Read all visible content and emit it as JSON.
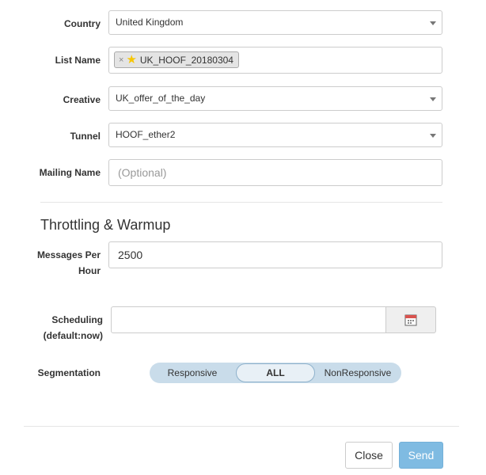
{
  "form": {
    "country": {
      "label": "Country",
      "value": "United Kingdom"
    },
    "list_name": {
      "label": "List Name",
      "tag_value": "UK_HOOF_20180304",
      "tag_remove": "×",
      "tag_icon": "star-icon"
    },
    "creative": {
      "label": "Creative",
      "value": "UK_offer_of_the_day"
    },
    "tunnel": {
      "label": "Tunnel",
      "value": "HOOF_ether2"
    },
    "mailing_name": {
      "label": "Mailing Name",
      "placeholder": "(Optional)"
    }
  },
  "throttling": {
    "title": "Throttling & Warmup",
    "messages_per_hour": {
      "label_line1": "Messages Per",
      "label_line2": "Hour",
      "value": "2500"
    },
    "scheduling": {
      "label_line1": "Scheduling",
      "label_line2": "(default:now)",
      "value": "",
      "icon": "calendar-icon"
    },
    "segmentation": {
      "label": "Segmentation",
      "options": [
        "Responsive",
        "ALL",
        "NonResponsive"
      ],
      "selected": "ALL"
    }
  },
  "footer": {
    "close_label": "Close",
    "send_label": "Send"
  },
  "colors": {
    "send_button": "#7fbbe2",
    "segment_bar": "#c9dcea",
    "tag_star": "#f7c600"
  }
}
